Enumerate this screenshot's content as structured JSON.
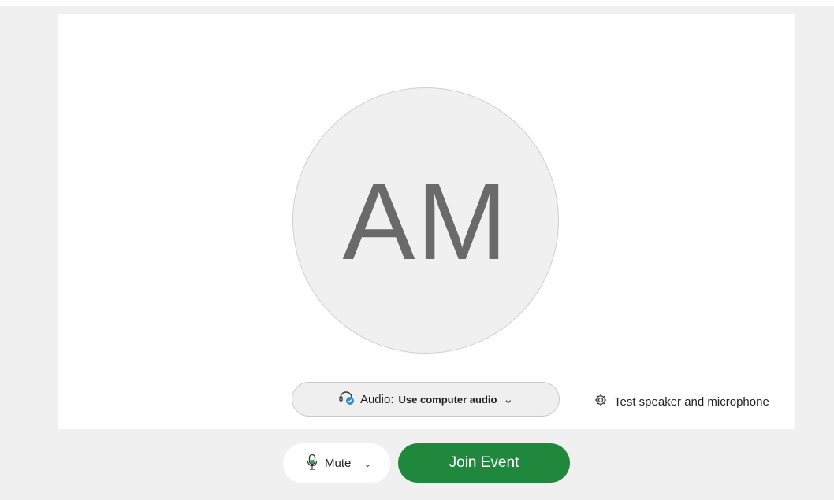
{
  "avatar": {
    "initials": "AM"
  },
  "audio": {
    "prefix": "Audio: ",
    "value": "Use computer audio",
    "chevron": "⌄"
  },
  "test": {
    "label": "Test speaker and microphone"
  },
  "mute": {
    "label": "Mute",
    "chevron": "⌄"
  },
  "join": {
    "label": "Join Event"
  },
  "colors": {
    "join_green": "#1f883d",
    "mic_green": "#2aa84a",
    "audio_badge_blue": "#2b8fd6"
  },
  "icons": {
    "audio": "headset-check-icon",
    "settings": "gear-icon",
    "mic": "microphone-icon"
  }
}
